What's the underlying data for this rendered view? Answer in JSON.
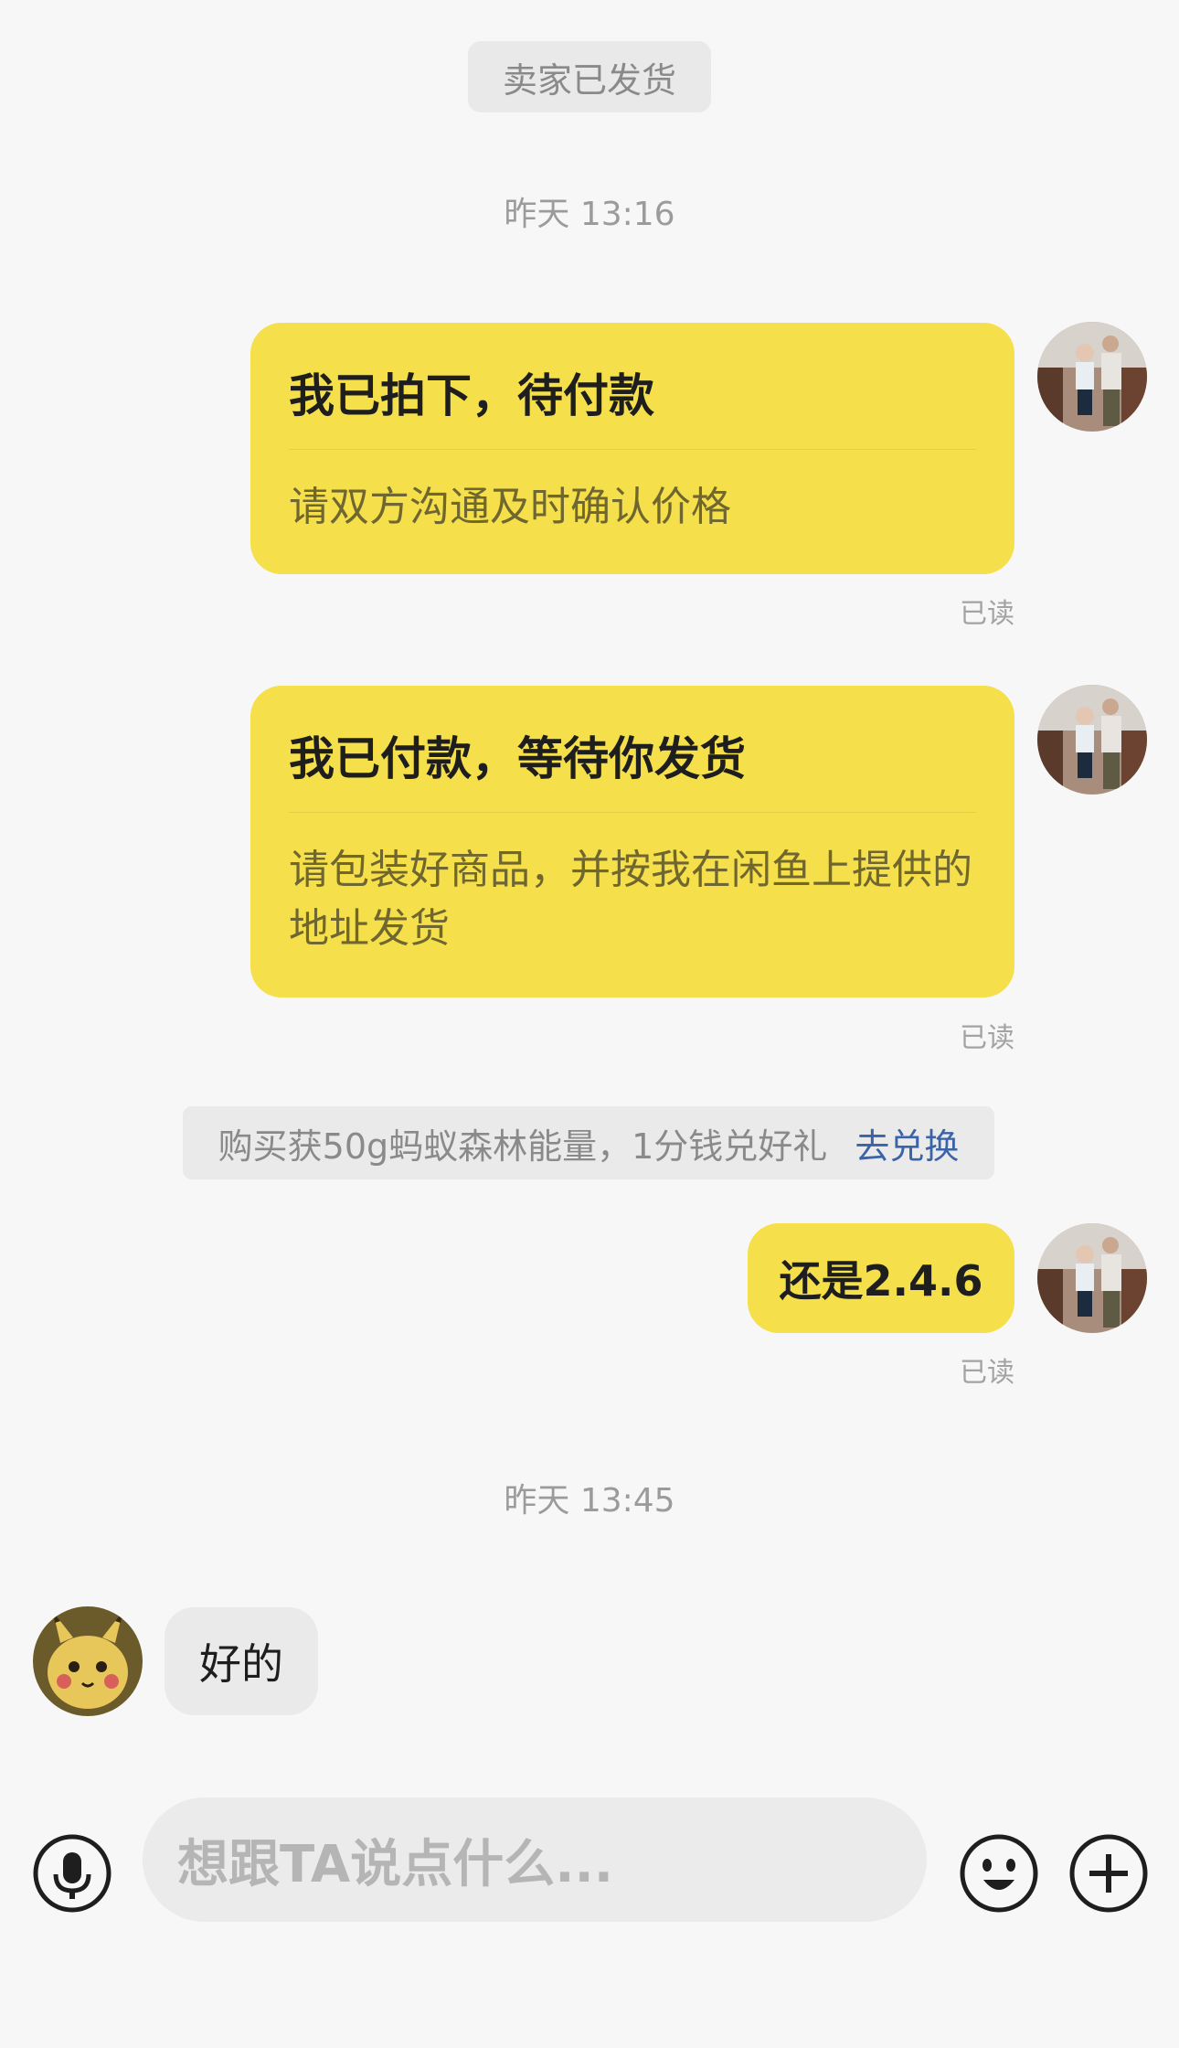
{
  "status_pill": "卖家已发货",
  "timestamp_1": "昨天 13:16",
  "cards": [
    {
      "title": "我已拍下，待付款",
      "subtitle": "请双方沟通及时确认价格",
      "read": "已读"
    },
    {
      "title": "我已付款，等待你发货",
      "subtitle": "请包装好商品，并按我在闲鱼上提供的地址发货",
      "read": "已读"
    }
  ],
  "promo": {
    "text": "购买获50g蚂蚁森林能量，1分钱兑好礼",
    "link": "去兑换"
  },
  "short_message": {
    "text": "还是2.4.6",
    "read": "已读"
  },
  "timestamp_2": "昨天 13:45",
  "incoming_message": "好的",
  "input": {
    "placeholder": "想跟TA说点什么..."
  },
  "icons": {
    "voice": "microphone-icon",
    "emoji": "smiley-icon",
    "more": "plus-icon"
  },
  "colors": {
    "bubble_yellow": "#f5e04b",
    "background": "#f7f7f7",
    "link_blue": "#3b63a8"
  }
}
